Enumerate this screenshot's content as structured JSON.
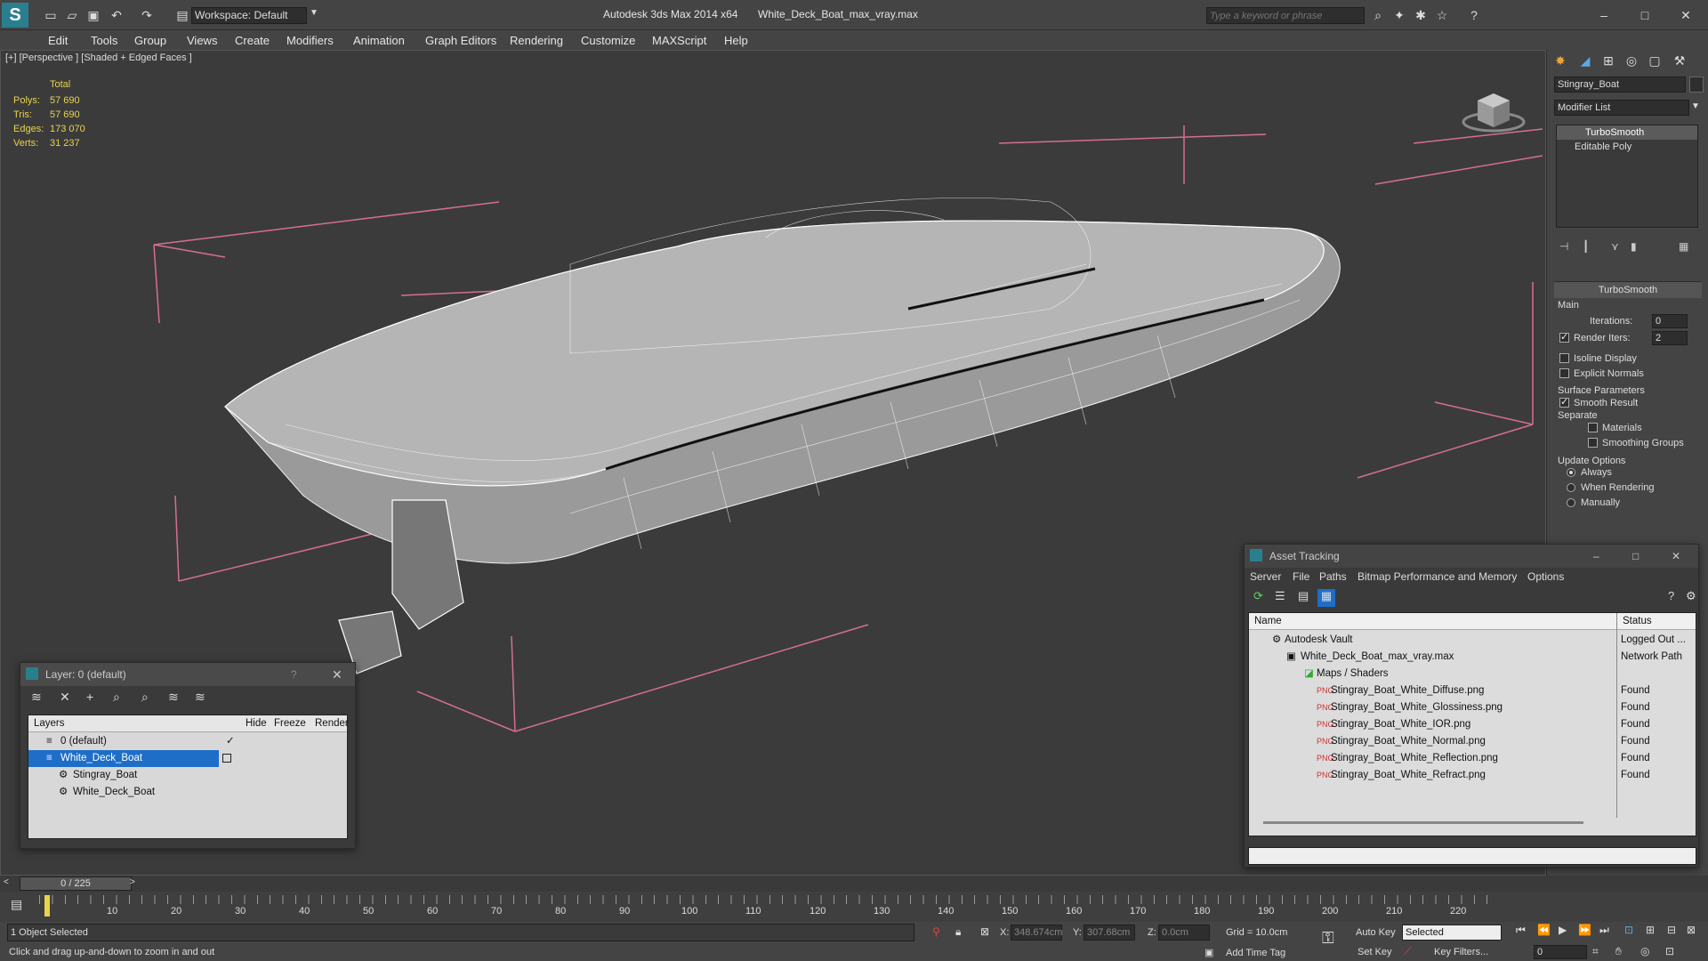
{
  "title": {
    "app": "Autodesk 3ds Max  2014 x64",
    "file": "White_Deck_Boat_max_vray.max"
  },
  "workspace": "Workspace: Default",
  "search_placeholder": "Type a keyword or phrase",
  "menu": [
    "Edit",
    "Tools",
    "Group",
    "Views",
    "Create",
    "Modifiers",
    "Animation",
    "Graph Editors",
    "Rendering",
    "Customize",
    "MAXScript",
    "Help"
  ],
  "viewport": {
    "label": "[+] [Perspective ] [Shaded + Edged Faces ]",
    "stats_header": "Total",
    "stats": [
      {
        "k": "Polys:",
        "v": "57 690"
      },
      {
        "k": "Tris:",
        "v": "57 690"
      },
      {
        "k": "Edges:",
        "v": "173 070"
      },
      {
        "k": "Verts:",
        "v": "31 237"
      }
    ]
  },
  "command_panel": {
    "object_name": "Stingray_Boat",
    "modifier_list": "Modifier List",
    "stack": [
      "TurboSmooth",
      "Editable Poly"
    ],
    "rollout_title": "TurboSmooth",
    "main_group": "Main",
    "iterations_label": "Iterations:",
    "iterations_value": "0",
    "render_iters_label": "Render Iters:",
    "render_iters_value": "2",
    "isoline": "Isoline Display",
    "explicit": "Explicit Normals",
    "surface_group": "Surface Parameters",
    "smooth_result": "Smooth Result",
    "separate": "Separate",
    "materials": "Materials",
    "smoothing_groups": "Smoothing Groups",
    "update_group": "Update Options",
    "always": "Always",
    "when_rendering": "When Rendering",
    "manually": "Manually"
  },
  "layer_window": {
    "title": "Layer: 0 (default)",
    "help": "?",
    "headers": {
      "layers": "Layers",
      "hide": "Hide",
      "freeze": "Freeze",
      "render": "Render"
    },
    "rows": [
      {
        "name": "0 (default)"
      },
      {
        "name": "White_Deck_Boat"
      },
      {
        "name": "Stingray_Boat"
      },
      {
        "name": "White_Deck_Boat"
      }
    ]
  },
  "asset_window": {
    "title": "Asset Tracking",
    "menu": [
      "Server",
      "File",
      "Paths",
      "Bitmap Performance and Memory",
      "Options"
    ],
    "headers": {
      "name": "Name",
      "status": "Status"
    },
    "rows": [
      {
        "name": "Autodesk Vault",
        "status": "Logged Out ..."
      },
      {
        "name": "White_Deck_Boat_max_vray.max",
        "status": "Network Path"
      },
      {
        "name": "Maps / Shaders",
        "status": ""
      },
      {
        "name": "Stingray_Boat_White_Diffuse.png",
        "status": "Found"
      },
      {
        "name": "Stingray_Boat_White_Glossiness.png",
        "status": "Found"
      },
      {
        "name": "Stingray_Boat_White_IOR.png",
        "status": "Found"
      },
      {
        "name": "Stingray_Boat_White_Normal.png",
        "status": "Found"
      },
      {
        "name": "Stingray_Boat_White_Reflection.png",
        "status": "Found"
      },
      {
        "name": "Stingray_Boat_White_Refract.png",
        "status": "Found"
      }
    ]
  },
  "timeline": {
    "frame": "0 / 225",
    "ticks": [
      "10",
      "20",
      "30",
      "40",
      "50",
      "60",
      "70",
      "80",
      "90",
      "100",
      "110",
      "120",
      "130",
      "140",
      "150",
      "160",
      "170",
      "180",
      "190",
      "200",
      "210",
      "220"
    ]
  },
  "status": {
    "selected": "1 Object Selected",
    "prompt": "Click and drag up-and-down to zoom in and out",
    "x_label": "X:",
    "x_value": "348.674cm",
    "y_label": "Y:",
    "y_value": "307.68cm",
    "z_label": "Z:",
    "z_value": "0.0cm",
    "grid": "Grid = 10.0cm",
    "auto_key": "Auto Key",
    "selected_dropdown": "Selected",
    "set_key": "Set Key",
    "key_filters": "Key Filters...",
    "add_time_tag": "Add Time Tag",
    "current_frame": "0"
  }
}
